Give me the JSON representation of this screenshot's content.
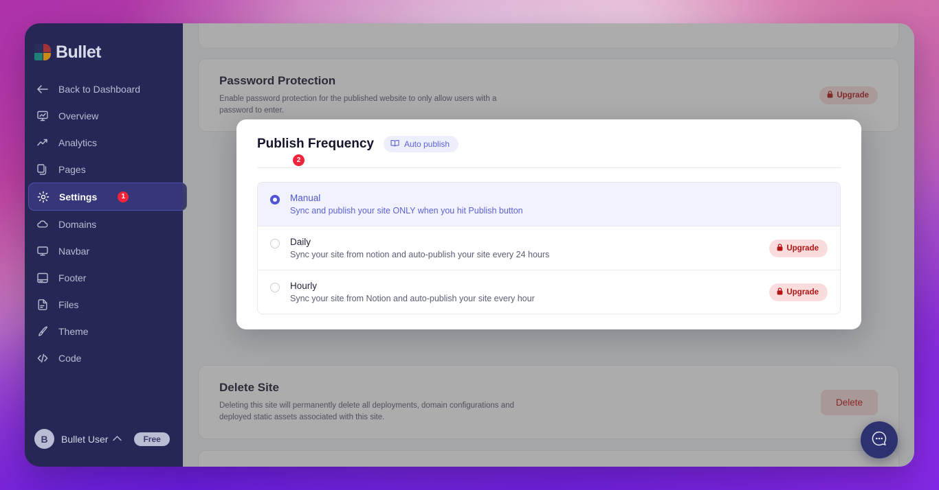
{
  "app": {
    "logo_text": "Bullet"
  },
  "sidebar": {
    "items": [
      {
        "label": "Back to Dashboard",
        "icon": "arrow-left-icon",
        "active": false,
        "badge": ""
      },
      {
        "label": "Overview",
        "icon": "presentation-chart-icon",
        "active": false,
        "badge": ""
      },
      {
        "label": "Analytics",
        "icon": "trending-up-icon",
        "active": false,
        "badge": ""
      },
      {
        "label": "Pages",
        "icon": "pages-copy-icon",
        "active": false,
        "badge": ""
      },
      {
        "label": "Settings",
        "icon": "gear-icon",
        "active": true,
        "badge": "1"
      },
      {
        "label": "Domains",
        "icon": "cloud-icon",
        "active": false,
        "badge": ""
      },
      {
        "label": "Navbar",
        "icon": "monitor-icon",
        "active": false,
        "badge": ""
      },
      {
        "label": "Footer",
        "icon": "footer-layout-icon",
        "active": false,
        "badge": ""
      },
      {
        "label": "Files",
        "icon": "document-icon",
        "active": false,
        "badge": ""
      },
      {
        "label": "Theme",
        "icon": "paintbrush-icon",
        "active": false,
        "badge": ""
      },
      {
        "label": "Code",
        "icon": "code-brackets-icon",
        "active": false,
        "badge": ""
      }
    ],
    "user": {
      "avatar_initial": "B",
      "name": "Bullet User",
      "chevron": "⌃",
      "plan": "Free"
    }
  },
  "password_protection": {
    "title": "Password Protection",
    "description": "Enable password protection for the published website to only allow users with a password to enter.",
    "upgrade_label": "Upgrade"
  },
  "publish_frequency": {
    "title": "Publish Frequency",
    "step_badge": "2",
    "auto_publish_label": "Auto publish",
    "options": [
      {
        "title": "Manual",
        "description": "Sync and publish your site ONLY when you hit Publish button",
        "selected": true,
        "upgrade_label": ""
      },
      {
        "title": "Daily",
        "description": "Sync your site from notion and auto-publish your site every 24 hours",
        "selected": false,
        "upgrade_label": "Upgrade"
      },
      {
        "title": "Hourly",
        "description": "Sync your site from Notion and auto-publish your site every hour",
        "selected": false,
        "upgrade_label": "Upgrade"
      }
    ]
  },
  "delete_site": {
    "title": "Delete Site",
    "description": "Deleting this site will permanently delete all deployments, domain configurations and deployed static assets associated with this site.",
    "button_label": "Delete"
  },
  "chat_widget": {
    "icon": "chat-bubble-ellipsis-icon"
  },
  "colors": {
    "sidebar_bg": "#272757",
    "accent_indigo": "#4f55d6",
    "badge_red": "#f1243b",
    "upgrade_red": "#b01414",
    "delete_red": "#c40b0b"
  }
}
